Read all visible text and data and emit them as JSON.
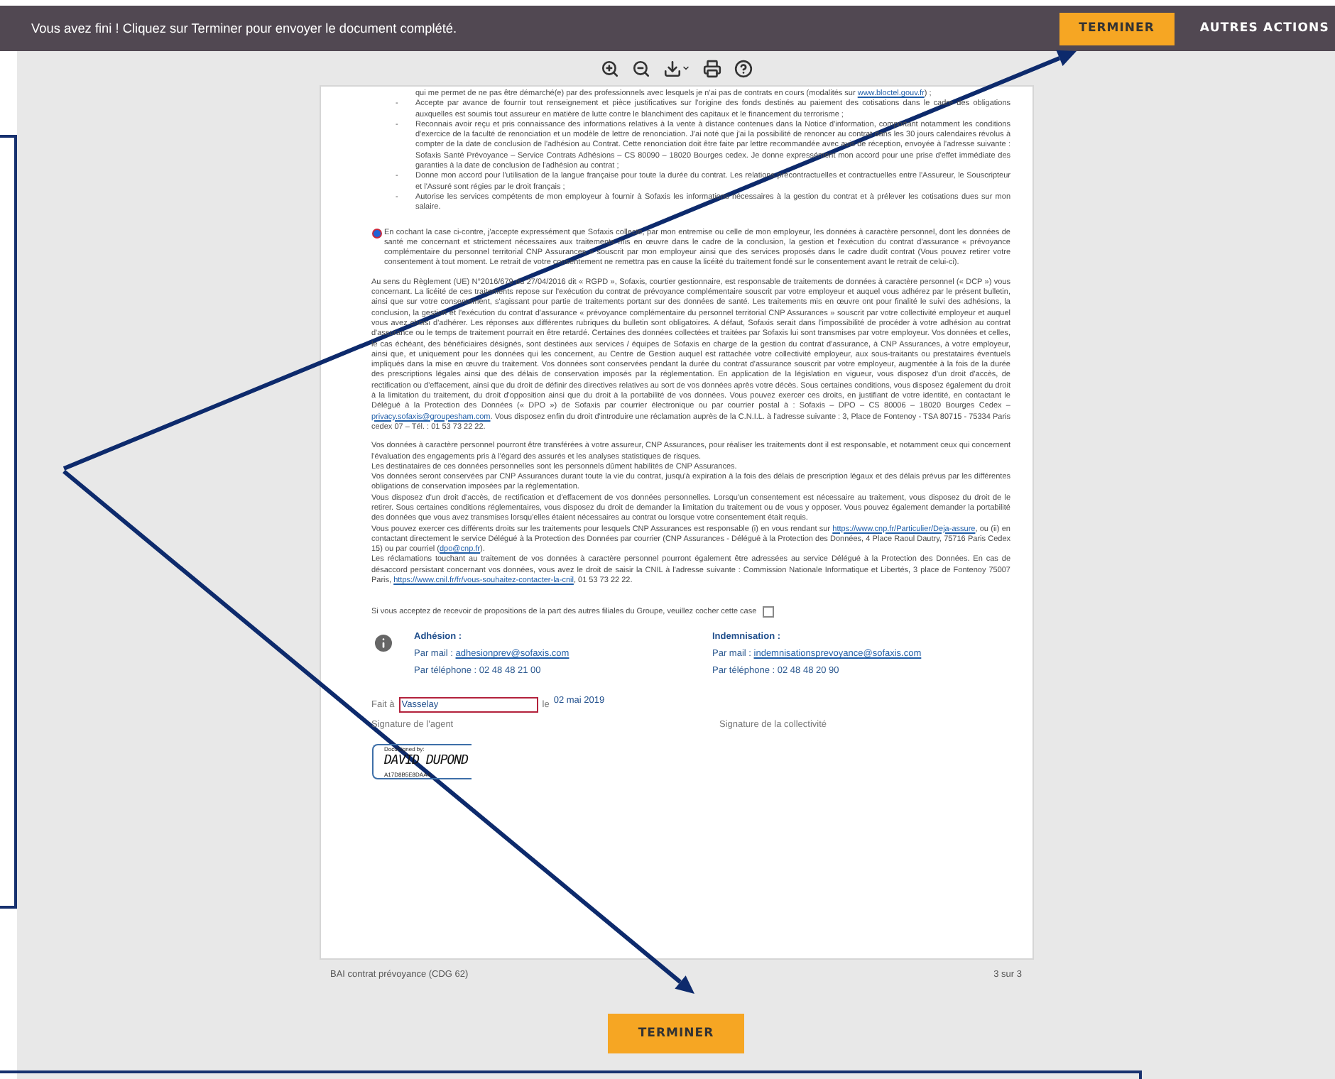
{
  "banner": {
    "message": "Vous avez fini ! Cliquez sur Terminer pour envoyer le document complété.",
    "finish_button": "TERMINER",
    "more_actions": "AUTRES ACTIONS"
  },
  "document": {
    "bullet_continuation": [
      {
        "text": "qui me permet de ne pas être démarché(e) par des professionnels avec lesquels je n'ai pas de contrats en cours (modalités sur "
      },
      {
        "text": "www.bloctel.gouv.fr",
        "link": true
      },
      {
        "text": ") ;"
      }
    ],
    "bullet_marker": "-",
    "bullets": [
      [
        {
          "text": "Accepte par avance de fournir tout renseignement et pièce justificatives sur l'origine des fonds destinés au paiement des cotisations dans le cadre des obligations auxquelles est soumis tout assureur en matière de lutte contre le blanchiment des capitaux et le financement du terrorisme ;"
        }
      ],
      [
        {
          "text": "Reconnais avoir reçu et pris connaissance des informations relatives à la vente à distance contenues dans la Notice d'information, comportant notamment les conditions d'exercice de la faculté de renonciation et un modèle de lettre de renonciation. J'ai noté que j'ai la possibilité de renoncer au contrat dans les 30 jours calendaires révolus à compter de la date de conclusion de l'adhésion au Contrat. Cette renonciation doit être faite par lettre recommandée avec avis de réception, envoyée à l'adresse suivante : Sofaxis Santé Prévoyance – Service Contrats Adhésions – CS 80090 – 18020 Bourges cedex. Je donne expressément mon accord pour une prise d'effet immédiate des garanties à la date de conclusion de l'adhésion au contrat ;"
        }
      ],
      [
        {
          "text": "Donne mon accord pour l'utilisation de la langue française pour toute la durée du contrat. Les relations précontractuelles et contractuelles entre l'Assureur, le Souscripteur et l'Assuré sont régies par le droit français ;"
        }
      ],
      [
        {
          "text": "Autorise les services compétents de mon employeur à fournir à Sofaxis les informations nécessaires à la gestion du contrat et à prélever les cotisations dues sur mon salaire."
        }
      ]
    ],
    "consent": {
      "selected": true,
      "text": "En cochant la case ci-contre, j'accepte expressément que Sofaxis collecte, par mon entremise ou celle de mon employeur, les données à caractère personnel, dont les données de santé me concernant et strictement nécessaires aux traitements mis en œuvre dans le cadre de la conclusion, la gestion et l'exécution du contrat d'assurance « prévoyance complémentaire du personnel territorial CNP Assurances » souscrit par mon employeur ainsi que des services proposés dans le cadre dudit contrat (Vous pouvez retirer votre consentement à tout moment. Le retrait de votre consentement ne remettra pas en cause la licéité du traitement fondé sur le consentement avant le retrait de celui-ci)."
    },
    "notice_blocks": [
      [
        [
          {
            "text": "Au sens du Règlement (UE) N°2016/679 du 27/04/2016 dit « RGPD », Sofaxis, courtier gestionnaire, est responsable de traitements de données à caractère personnel (« DCP ») vous concernant. La licéité de ces traitements repose sur l'exécution du contrat de prévoyance complémentaire souscrit par votre employeur et auquel vous adhérez par le présent bulletin, ainsi que sur votre consentement, s'agissant pour partie de traitements portant sur des données de santé. Les traitements mis en œuvre ont pour finalité le suivi des adhésions, la conclusion, la gestion et l'exécution du contrat d'assurance « prévoyance complémentaire du personnel territorial CNP Assurances » souscrit par votre collectivité employeur et auquel vous avez choisi d'adhérer. Les réponses aux différentes rubriques du bulletin sont obligatoires. A défaut, Sofaxis serait dans l'impossibilité de procéder à votre adhésion au contrat d'assurance ou le temps de traitement pourrait en être retardé. Certaines des données collectées et traitées par Sofaxis lui sont transmises par votre employeur. Vos données et celles, le cas échéant, des bénéficiaires désignés, sont destinées aux services / équipes de Sofaxis en charge de la gestion du contrat d'assurance, à CNP Assurances, à votre employeur, ainsi que, et uniquement pour les données qui les concernent, au Centre de Gestion auquel est rattachée votre collectivité employeur, aux sous-traitants ou prestataires éventuels impliqués dans la mise en œuvre du traitement. Vos données sont conservées pendant la durée du contrat d'assurance souscrit par votre employeur, augmentée à la fois de la durée des prescriptions légales ainsi que des délais de conservation imposés par la réglementation. En application de la législation en vigueur, vous disposez d'un droit d'accès, de rectification ou d'effacement, ainsi que du droit de définir des directives relatives au sort de vos données après votre décès. Sous certaines conditions, vous disposez également du droit à la limitation du traitement, du droit d'opposition ainsi que du droit à la portabilité de vos données. Vous pouvez exercer ces droits, en justifiant de votre identité, en contactant le Délégué à la Protection des Données (« DPO ») de Sofaxis par courrier électronique ou par courrier postal à : Sofaxis – DPO – CS 80006 – 18020 Bourges Cedex – "
          },
          {
            "text": "privacy.sofaxis@groupesham.com",
            "link": true
          },
          {
            "text": ". Vous disposez enfin du droit d'introduire une réclamation auprès de la C.N.I.L. à l'adresse suivante : 3, Place de Fontenoy - TSA 80715 - 75334 Paris cedex 07 – Tél. : 01 53 73 22 22."
          }
        ]
      ],
      [
        [
          {
            "text": "Vos données à caractère personnel pourront être transférées à votre assureur, CNP Assurances, pour réaliser les traitements dont il est responsable, et notamment ceux qui concernent l'évaluation des engagements pris à l'égard des assurés et les analyses statistiques de risques."
          }
        ],
        [
          {
            "text": "Les destinataires de ces données personnelles sont les personnels dûment habilités de CNP Assurances."
          }
        ],
        [
          {
            "text": "Vos données seront conservées par CNP Assurances durant toute la vie du contrat, jusqu'à expiration à la fois des délais de prescription légaux et des délais prévus par les différentes obligations de conservation imposées par la réglementation."
          }
        ],
        [
          {
            "text": "Vous disposez d'un droit d'accès, de rectification et d'effacement de vos données personnelles. Lorsqu'un consentement est nécessaire au traitement, vous disposez du droit de le retirer. Sous certaines conditions réglementaires, vous disposez du droit de demander la limitation du traitement ou de vous y opposer. Vous pouvez également demander la portabilité des données que vous avez transmises lorsqu'elles étaient nécessaires au contrat ou lorsque votre consentement était requis."
          }
        ],
        [
          {
            "text": "Vous pouvez exercer ces différents droits sur les traitements pour lesquels CNP Assurances est responsable (i) en vous rendant sur "
          },
          {
            "text": "https://www.cnp.fr/Particulier/Deja-assure",
            "link": true
          },
          {
            "text": ", ou (ii) en contactant directement le service Délégué à la Protection des Données par courrier (CNP Assurances - Délégué à la Protection des Données, 4 Place Raoul Dautry, 75716 Paris Cedex 15) ou par courriel ("
          },
          {
            "text": "dpo@cnp.fr",
            "link": true
          },
          {
            "text": ")."
          }
        ],
        [
          {
            "text": "Les réclamations touchant au traitement de vos données à caractère personnel pourront également être adressées au service Délégué à la Protection des Données. En cas de désaccord persistant concernant vos données, vous avez le droit de saisir la CNIL à l'adresse suivante : Commission Nationale Informatique et Libertés, 3 place de Fontenoy 75007 Paris, "
          },
          {
            "text": "https://www.cnil.fr/fr/vous-souhaitez-contacter-la-cnil",
            "link": true
          },
          {
            "text": ", 01 53 73 22 22."
          }
        ]
      ]
    ],
    "offers_checkbox": {
      "label": "Si vous acceptez de recevoir de propositions de la part des autres filiales du Groupe, veuillez cocher cette case",
      "checked": false
    },
    "contacts": [
      {
        "title": "Adhésion :",
        "mail_label": "Par mail : ",
        "mail": "adhesionprev@sofaxis.com",
        "phone": "Par téléphone : 02 48 48 21 00"
      },
      {
        "title": "Indemnisation :",
        "mail_label": "Par mail : ",
        "mail": "indemnisationsprevoyance@sofaxis.com",
        "phone": "Par téléphone : 02 48 48 20 90"
      }
    ],
    "place_label": "Fait à",
    "place_value": "Vasselay",
    "date_label": "le",
    "date": "02 mai 2019",
    "signature_labels": [
      "Signature de l'agent",
      "Signature de la collectivité"
    ],
    "signature": {
      "header": "DocuSigned by:",
      "name": "DAVID DUPOND",
      "id": "A17D8B5E8DAA4..."
    }
  },
  "footer": {
    "document_name": "BAI contrat prévoyance (CDG 62)",
    "page": "3 sur 3"
  },
  "finish_button": "TERMINER"
}
